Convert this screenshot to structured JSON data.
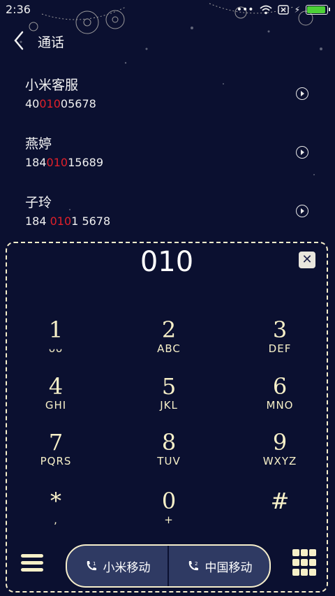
{
  "status": {
    "time": "2:36"
  },
  "header": {
    "title": "通话"
  },
  "contacts": [
    {
      "name": "小米客服",
      "pre": "40",
      "match": "010",
      "post": "05678"
    },
    {
      "name": "燕婷",
      "pre": "184",
      "match": "010",
      "post": "15689"
    },
    {
      "name": "子玲",
      "pre": "184 ",
      "match": "010",
      "post": "1 5678"
    }
  ],
  "dialer": {
    "input": "010",
    "keys": [
      {
        "digit": "1",
        "letters": "ᴗᴗ"
      },
      {
        "digit": "2",
        "letters": "ABC"
      },
      {
        "digit": "3",
        "letters": "DEF"
      },
      {
        "digit": "4",
        "letters": "GHI"
      },
      {
        "digit": "5",
        "letters": "JKL"
      },
      {
        "digit": "6",
        "letters": "MNO"
      },
      {
        "digit": "7",
        "letters": "PQRS"
      },
      {
        "digit": "8",
        "letters": "TUV"
      },
      {
        "digit": "9",
        "letters": "WXYZ"
      },
      {
        "digit": "*",
        "letters": ","
      },
      {
        "digit": "0",
        "letters": "+"
      },
      {
        "digit": "#",
        "letters": ""
      }
    ]
  },
  "sim_buttons": {
    "sim1_label": "小米移动",
    "sim2_label": "中国移动"
  },
  "colors": {
    "background": "#0b1030",
    "accent": "#f7f0c8",
    "highlight": "#e0202a",
    "battery": "#4cd137"
  }
}
